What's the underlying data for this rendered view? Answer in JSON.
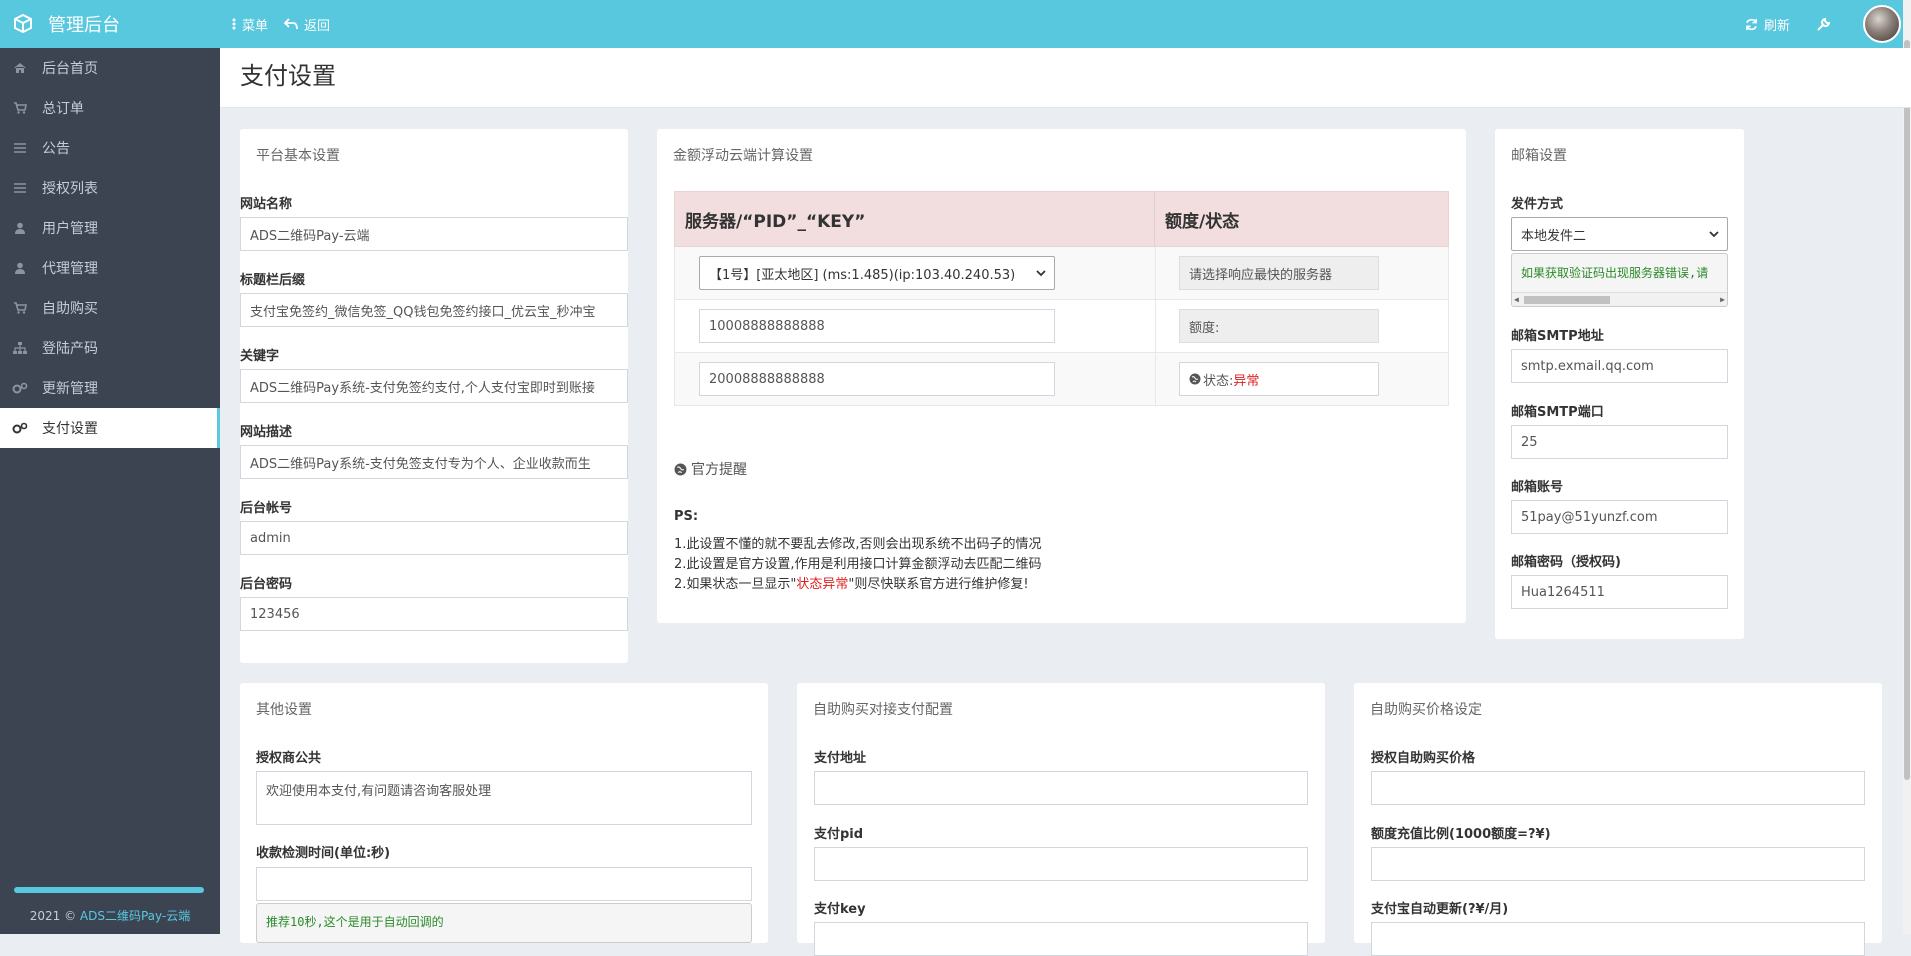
{
  "app": {
    "title": "管理后台"
  },
  "topbar": {
    "menu_label": "菜单",
    "back_label": "返回",
    "refresh_label": "刷新"
  },
  "sidebar": {
    "items": [
      {
        "label": "后台首页",
        "icon": "home-icon"
      },
      {
        "label": "总订单",
        "icon": "cart-icon"
      },
      {
        "label": "公告",
        "icon": "list-icon"
      },
      {
        "label": "授权列表",
        "icon": "list-icon"
      },
      {
        "label": "用户管理",
        "icon": "user-icon"
      },
      {
        "label": "代理管理",
        "icon": "user-icon"
      },
      {
        "label": "自助购买",
        "icon": "cart-icon"
      },
      {
        "label": "登陆产码",
        "icon": "sitemap-icon"
      },
      {
        "label": "更新管理",
        "icon": "cogs-icon"
      },
      {
        "label": "支付设置",
        "icon": "cogs-icon",
        "active": true
      }
    ],
    "footer_prefix": "2021 © ",
    "footer_link": "ADS二维码Pay-云端"
  },
  "page": {
    "title": "支付设置"
  },
  "basic": {
    "heading": "平台基本设置",
    "site_name_label": "网站名称",
    "site_name_value": "ADS二维码Pay-云端",
    "title_suffix_label": "标题栏后缀",
    "title_suffix_value": "支付宝免签约_微信免签_QQ钱包免签约接口_优云宝_秒冲宝",
    "keywords_label": "关键字",
    "keywords_value": "ADS二维码Pay系统-支付免签约支付,个人支付宝即时到账接",
    "desc_label": "网站描述",
    "desc_value": "ADS二维码Pay系统-支付免签支付专为个人、企业收款而生",
    "admin_user_label": "后台帐号",
    "admin_user_value": "admin",
    "admin_pass_label": "后台密码",
    "admin_pass_value": "123456"
  },
  "cloud": {
    "heading": "金额浮动云端计算设置",
    "col1": "服务器/“PID”_“KEY”",
    "col2": "额度/状态",
    "server_select": "【1号】[亚太地区] (ms:1.485)(ip:103.40.240.53)",
    "server_hint": "请选择响应最快的服务器",
    "pid_value": "10008888888888",
    "quota_label": "额度:",
    "key_value": "20008888888888",
    "status_label": "状态:",
    "status_value": "异常",
    "notice_title": "官方提醒",
    "ps_label": "PS:",
    "ps_line1": "1.此设置不懂的就不要乱去修改,否则会出现系统不出码子的情况",
    "ps_line2": "2.此设置是官方设置,作用是利用接口计算金额浮动去匹配二维码",
    "ps_line3_a": "2.如果状态一旦显示\"",
    "ps_line3_red": "状态异常",
    "ps_line3_b": "\"则尽快联系官方进行维护修复!"
  },
  "mail": {
    "heading": "邮箱设置",
    "method_label": "发件方式",
    "method_value": "本地发件二",
    "method_hint": "如果获取验证码出现服务器错误,请",
    "smtp_host_label": "邮箱SMTP地址",
    "smtp_host_value": "smtp.exmail.qq.com",
    "smtp_port_label": "邮箱SMTP端口",
    "smtp_port_value": "25",
    "account_label": "邮箱账号",
    "account_value": "51pay@51yunzf.com",
    "password_label": "邮箱密码（授权码)",
    "password_value": "Hua1264511"
  },
  "other": {
    "heading": "其他设置",
    "notice_label": "授权商公共",
    "notice_value": "欢迎使用本支付,有问题请咨询客服处理",
    "check_time_label": "收款检测时间(单位:秒)",
    "check_time_value": "",
    "check_time_hint": "推荐10秒,这个是用于自动回调的"
  },
  "selfpay": {
    "heading": "自助购买对接支付配置",
    "url_label": "支付地址",
    "pid_label": "支付pid",
    "key_label": "支付key"
  },
  "price": {
    "heading": "自助购买价格设定",
    "license_label": "授权自助购买价格",
    "ratio_label": "额度充值比例(1000额度=?¥)",
    "alipay_label": "支付宝自动更新(?¥/月)"
  }
}
